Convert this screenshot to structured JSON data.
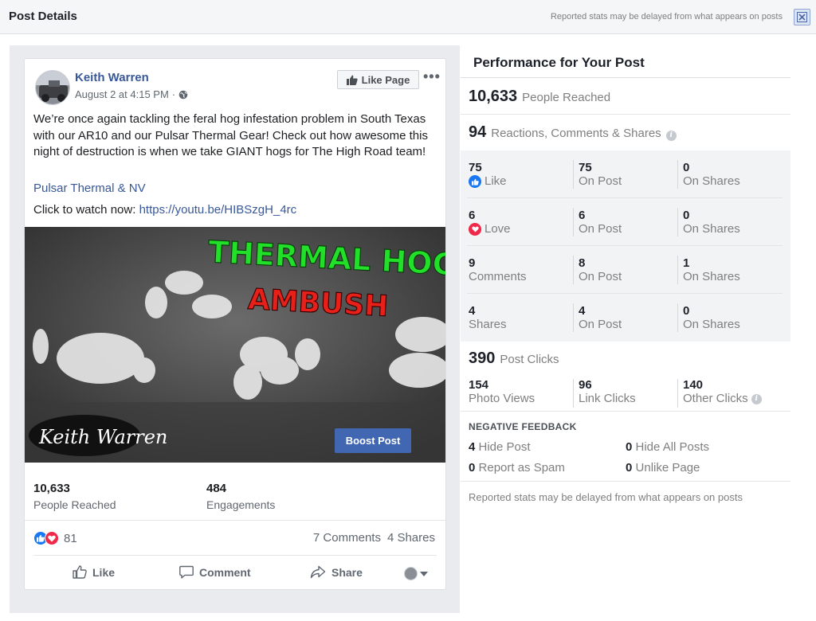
{
  "header": {
    "title": "Post Details",
    "note": "Reported stats may be delayed from what appears on posts"
  },
  "post": {
    "author": "Keith Warren",
    "date": "August 2 at 4:15 PM",
    "like_page_label": "Like Page",
    "more_label": "•••",
    "text": "We’re once again tackling the feral hog infestation problem in South Texas with our AR10 and our Pulsar Thermal Gear! Check out how awesome this night of destruction is when we take GIANT hogs for The High Road team!",
    "link_tag": "Pulsar Thermal & NV",
    "cta_text": "Click to watch now:",
    "cta_link": "https://youtu.be/HIBSzgH_4rc",
    "video": {
      "title_line1": "THERMAL HOG",
      "title_line2": "AMBUSH",
      "signature": "Keith Warren"
    },
    "reached_value": "10,633",
    "reached_label": "People Reached",
    "engagements_value": "484",
    "engagements_label": "Engagements",
    "boost_label": "Boost Post",
    "reactions_count": "81",
    "comments": "7 Comments",
    "shares": "4 Shares",
    "actions": {
      "like": "Like",
      "comment": "Comment",
      "share": "Share"
    }
  },
  "performance": {
    "title": "Performance for Your Post",
    "people_reached_value": "10,633",
    "people_reached_label": "People Reached",
    "engagement_value": "94",
    "engagement_label": "Reactions, Comments & Shares",
    "rows": [
      {
        "value": "75",
        "label": "Like",
        "on_post": "75",
        "on_post_label": "On Post",
        "on_shares": "0",
        "on_shares_label": "On Shares"
      },
      {
        "value": "6",
        "label": "Love",
        "on_post": "6",
        "on_post_label": "On Post",
        "on_shares": "0",
        "on_shares_label": "On Shares"
      },
      {
        "value": "9",
        "label": "Comments",
        "on_post": "8",
        "on_post_label": "On Post",
        "on_shares": "1",
        "on_shares_label": "On Shares"
      },
      {
        "value": "4",
        "label": "Shares",
        "on_post": "4",
        "on_post_label": "On Post",
        "on_shares": "0",
        "on_shares_label": "On Shares"
      }
    ],
    "post_clicks_value": "390",
    "post_clicks_label": "Post Clicks",
    "photo_views_value": "154",
    "photo_views_label": "Photo Views",
    "link_clicks_value": "96",
    "link_clicks_label": "Link Clicks",
    "other_clicks_value": "140",
    "other_clicks_label": "Other Clicks",
    "negative_title": "NEGATIVE FEEDBACK",
    "hide_post_value": "4",
    "hide_post_label": "Hide Post",
    "hide_all_value": "0",
    "hide_all_label": "Hide All Posts",
    "spam_value": "0",
    "spam_label": "Report as Spam",
    "unlike_value": "0",
    "unlike_label": "Unlike Page",
    "footer_note": "Reported stats may be delayed from what appears on posts"
  },
  "colors": {
    "brand_blue": "#4267b2",
    "link_blue": "#385898",
    "love_red": "#f0284a",
    "like_blue": "#1877f2"
  }
}
